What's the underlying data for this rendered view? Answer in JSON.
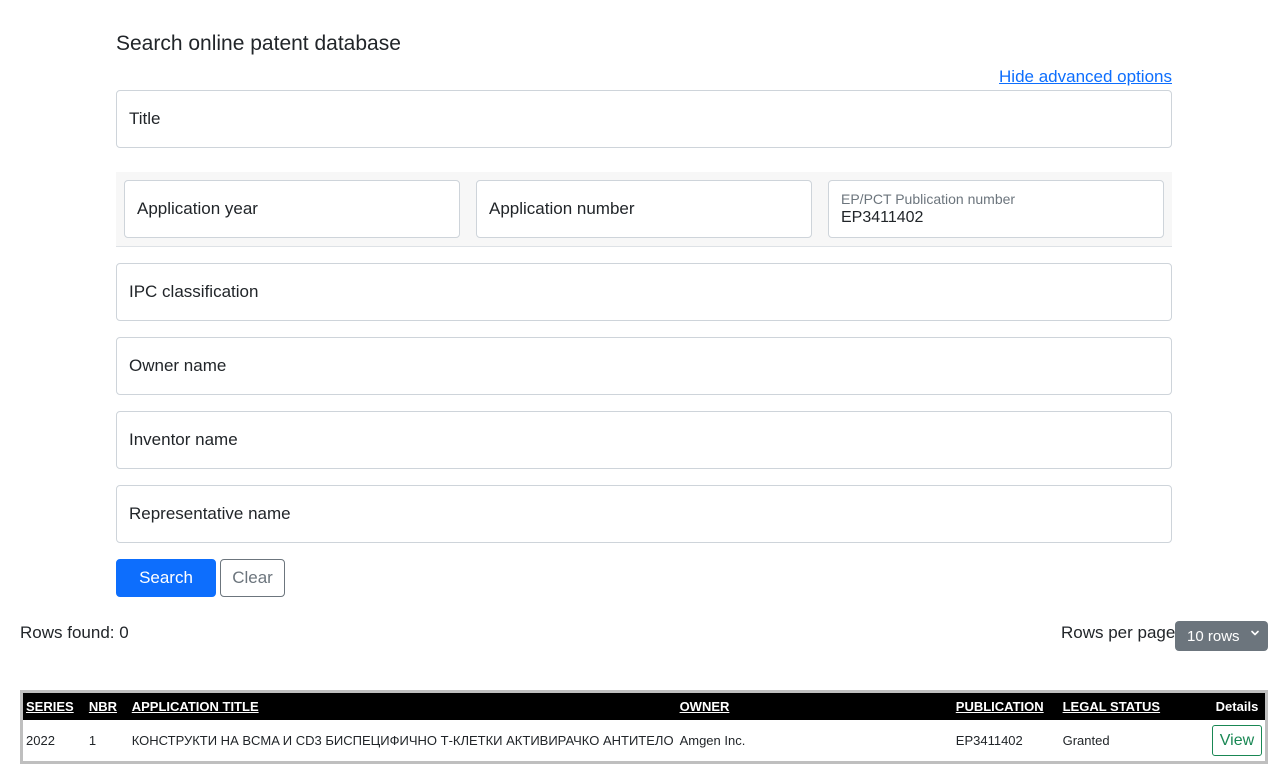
{
  "page": {
    "heading": "Search online patent database",
    "advanced_link": "Hide advanced options"
  },
  "fields": {
    "title": "Title",
    "application_year": "Application year",
    "application_number": "Application number",
    "publication_label": "EP/PCT Publication number",
    "publication_value": "EP3411402",
    "ipc": "IPC classification",
    "owner": "Owner name",
    "inventor": "Inventor name",
    "representative": "Representative name"
  },
  "buttons": {
    "search": "Search",
    "clear": "Clear"
  },
  "results": {
    "rows_found": "Rows found: 0",
    "rows_per_page_label": "Rows per page",
    "rows_per_page_value": "10 rows"
  },
  "table": {
    "headers": [
      "SERIES",
      "NBR",
      "APPLICATION TITLE",
      "OWNER",
      "PUBLICATION",
      "LEGAL STATUS",
      "Details"
    ],
    "rows": [
      {
        "series": "2022",
        "nbr": "1",
        "title": "КОНСТРУКТИ НА BCMA И CD3 БИСПЕЦИФИЧНО Т-КЛЕТКИ АКТИВИРАЧКО АНТИТЕЛО",
        "owner": "Amgen Inc.",
        "publication": "EP3411402",
        "legal_status": "Granted",
        "details": "View"
      }
    ]
  },
  "colors": {
    "primary": "#0d6efd",
    "secondary": "#6c757d",
    "success": "#198754",
    "header_bg": "#000000"
  },
  "icons": {
    "select_chevron": "chevron-down-icon"
  }
}
